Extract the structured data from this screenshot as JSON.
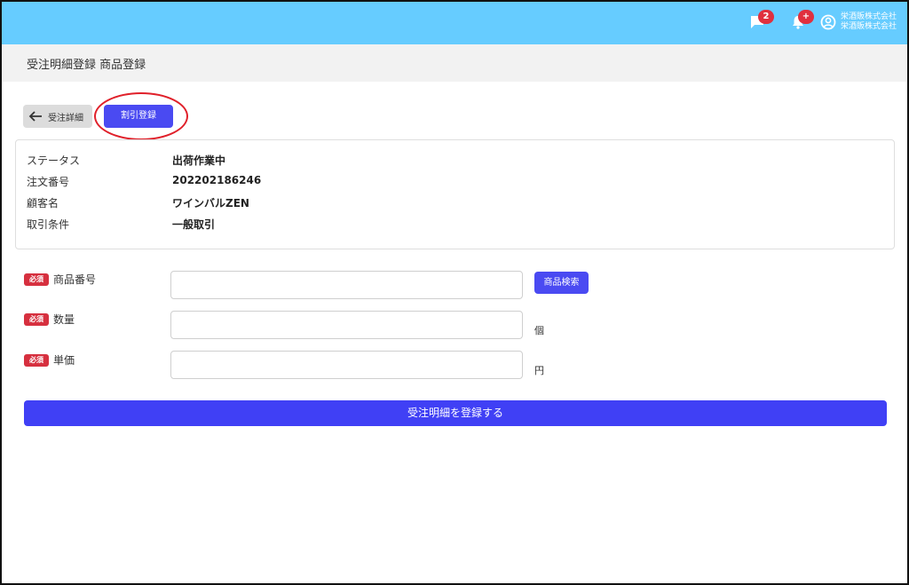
{
  "topbar": {
    "chat_badge": "2",
    "bell_badge": "+",
    "company_line1": "栄酒販株式会社",
    "company_line2": "栄酒販株式会社",
    "bg_color": "#66ccff"
  },
  "page": {
    "title": "受注明細登録 商品登録"
  },
  "actions": {
    "back_label": "受注詳細",
    "discount_label": "割引登録"
  },
  "info": {
    "rows": [
      {
        "label": "ステータス",
        "value": "出荷作業中"
      },
      {
        "label": "注文番号",
        "value": "202202186246"
      },
      {
        "label": "顧客名",
        "value": "ワインバルZEN"
      },
      {
        "label": "取引条件",
        "value": "一般取引"
      }
    ]
  },
  "form": {
    "required_tag": "必須",
    "product_number_label": "商品番号",
    "product_number_value": "",
    "product_search_label": "商品検索",
    "quantity_label": "数量",
    "quantity_value": "",
    "quantity_unit": "個",
    "unit_price_label": "単価",
    "unit_price_value": "",
    "unit_price_unit": "円",
    "submit_label": "受注明細を登録する"
  },
  "colors": {
    "primary": "#4a4af2",
    "required": "#d6303f",
    "highlight": "#e0202a"
  }
}
